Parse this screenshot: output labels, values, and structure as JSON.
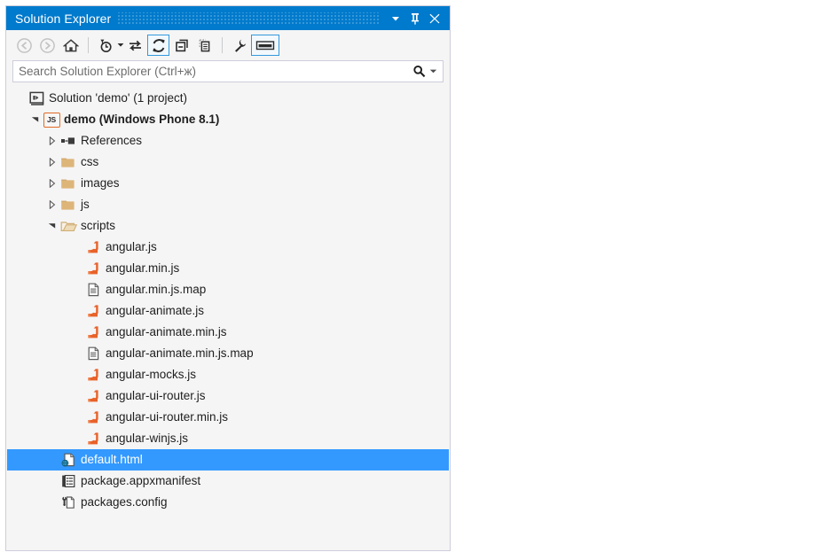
{
  "window": {
    "title": "Solution Explorer",
    "accent_color": "#007acc",
    "selection_color": "#3399ff",
    "panel_bg": "#f5f5f5",
    "buttons": [
      {
        "name": "window-menu-dropdown",
        "label": "▾"
      },
      {
        "name": "auto-hide-pin",
        "label": "Pin"
      },
      {
        "name": "close-window",
        "label": "✕"
      }
    ]
  },
  "toolbar": {
    "items": [
      {
        "name": "back-button",
        "tooltip": "Back",
        "enabled": false
      },
      {
        "name": "forward-button",
        "tooltip": "Forward",
        "enabled": false
      },
      {
        "name": "home-button",
        "tooltip": "Home",
        "enabled": true
      },
      {
        "name": "pending-changes-filter-button",
        "tooltip": "Pending Changes Filter",
        "enabled": true
      },
      {
        "name": "sync-with-active-document-button",
        "tooltip": "Sync with Active Document",
        "enabled": true
      },
      {
        "name": "refresh-button",
        "tooltip": "Refresh",
        "enabled": true,
        "highlighted": true
      },
      {
        "name": "collapse-all-button",
        "tooltip": "Collapse All",
        "enabled": true
      },
      {
        "name": "show-all-files-button",
        "tooltip": "Show All Files",
        "enabled": true
      },
      {
        "name": "properties-button",
        "tooltip": "Properties",
        "enabled": true
      },
      {
        "name": "preview-selected-items-button",
        "tooltip": "Preview Selected Items",
        "enabled": true,
        "highlighted": true
      }
    ]
  },
  "search": {
    "placeholder": "Search Solution Explorer (Ctrl+ж)",
    "value": ""
  },
  "tree": {
    "nodes": [
      {
        "label": "Solution 'demo' (1 project)",
        "icon": "solution-icon",
        "indent": 0,
        "twisty": "none",
        "bold": false,
        "selected": false
      },
      {
        "label": "demo (Windows Phone 8.1)",
        "icon": "js-project-badge",
        "indent": 1,
        "twisty": "expanded",
        "bold": true,
        "selected": false
      },
      {
        "label": "References",
        "icon": "references-icon",
        "indent": 2,
        "twisty": "collapsed",
        "bold": false,
        "selected": false
      },
      {
        "label": "css",
        "icon": "folder-closed-icon",
        "indent": 2,
        "twisty": "collapsed",
        "bold": false,
        "selected": false
      },
      {
        "label": "images",
        "icon": "folder-closed-icon",
        "indent": 2,
        "twisty": "collapsed",
        "bold": false,
        "selected": false
      },
      {
        "label": "js",
        "icon": "folder-closed-icon",
        "indent": 2,
        "twisty": "collapsed",
        "bold": false,
        "selected": false
      },
      {
        "label": "scripts",
        "icon": "folder-open-icon",
        "indent": 2,
        "twisty": "expanded",
        "bold": false,
        "selected": false
      },
      {
        "label": "angular.js",
        "icon": "js-file-icon",
        "indent": 3,
        "twisty": "none",
        "bold": false,
        "selected": false
      },
      {
        "label": "angular.min.js",
        "icon": "js-file-icon",
        "indent": 3,
        "twisty": "none",
        "bold": false,
        "selected": false
      },
      {
        "label": "angular.min.js.map",
        "icon": "map-file-icon",
        "indent": 3,
        "twisty": "none",
        "bold": false,
        "selected": false
      },
      {
        "label": "angular-animate.js",
        "icon": "js-file-icon",
        "indent": 3,
        "twisty": "none",
        "bold": false,
        "selected": false
      },
      {
        "label": "angular-animate.min.js",
        "icon": "js-file-icon",
        "indent": 3,
        "twisty": "none",
        "bold": false,
        "selected": false
      },
      {
        "label": "angular-animate.min.js.map",
        "icon": "map-file-icon",
        "indent": 3,
        "twisty": "none",
        "bold": false,
        "selected": false
      },
      {
        "label": "angular-mocks.js",
        "icon": "js-file-icon",
        "indent": 3,
        "twisty": "none",
        "bold": false,
        "selected": false
      },
      {
        "label": "angular-ui-router.js",
        "icon": "js-file-icon",
        "indent": 3,
        "twisty": "none",
        "bold": false,
        "selected": false
      },
      {
        "label": "angular-ui-router.min.js",
        "icon": "js-file-icon",
        "indent": 3,
        "twisty": "none",
        "bold": false,
        "selected": false
      },
      {
        "label": "angular-winjs.js",
        "icon": "js-file-icon",
        "indent": 3,
        "twisty": "none",
        "bold": false,
        "selected": false
      },
      {
        "label": "default.html",
        "icon": "html-file-icon",
        "indent": 2,
        "twisty": "none",
        "bold": false,
        "selected": true
      },
      {
        "label": "package.appxmanifest",
        "icon": "manifest-file-icon",
        "indent": 2,
        "twisty": "none",
        "bold": false,
        "selected": false
      },
      {
        "label": "packages.config",
        "icon": "config-file-icon",
        "indent": 2,
        "twisty": "none",
        "bold": false,
        "selected": false
      }
    ]
  }
}
